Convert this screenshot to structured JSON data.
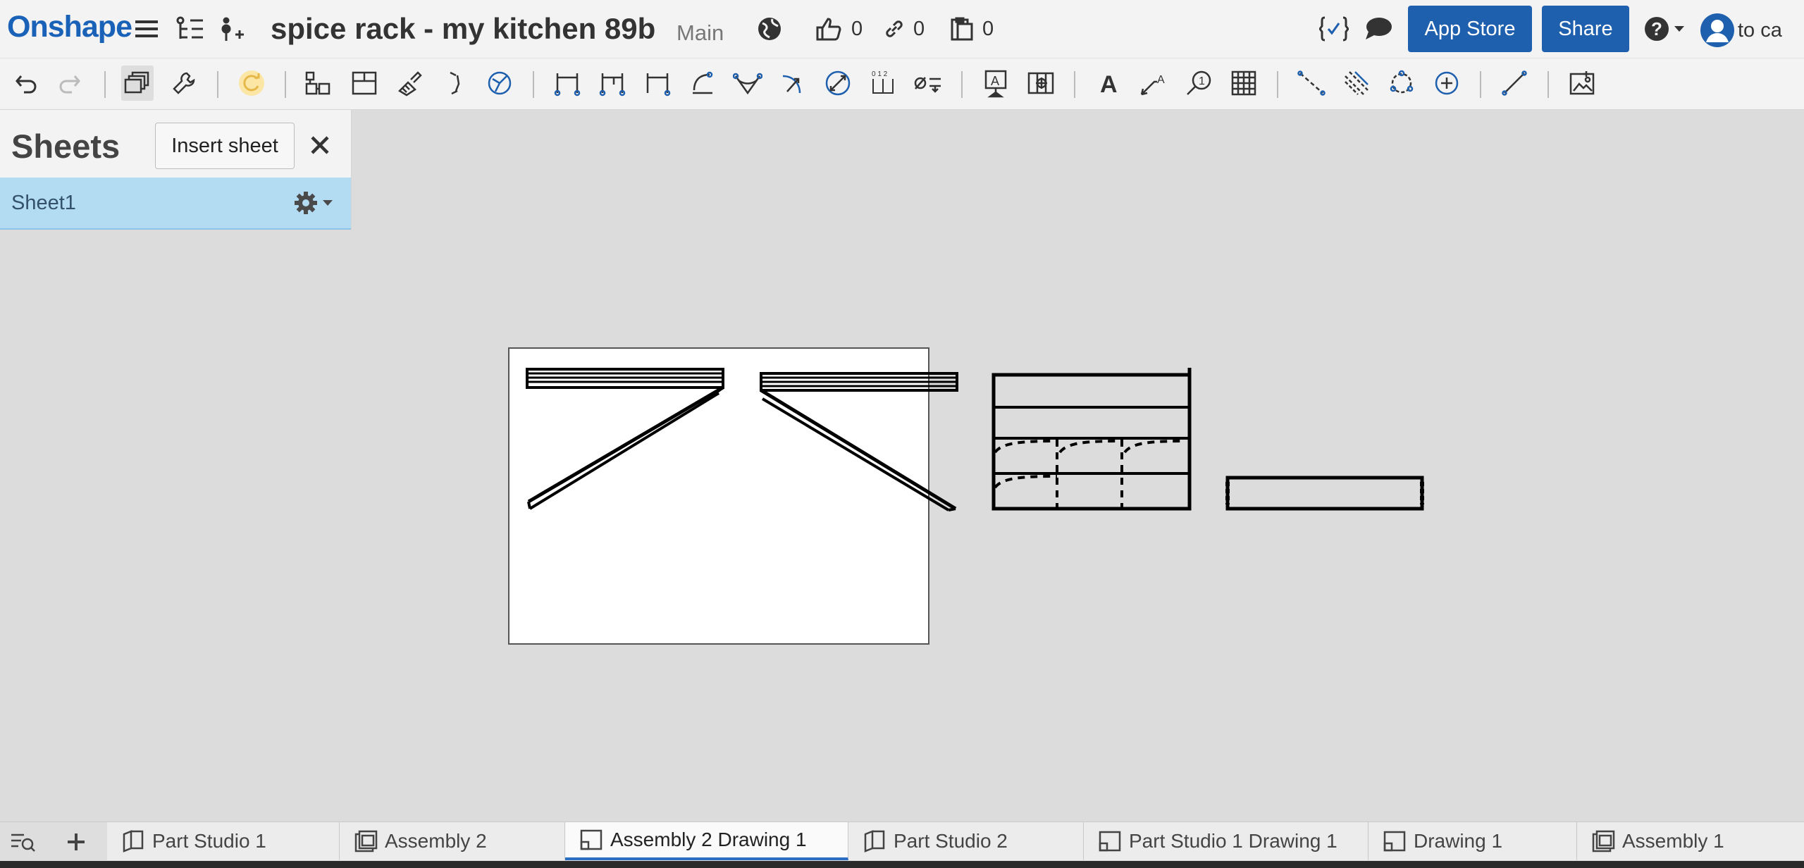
{
  "header": {
    "logo": "Onshape",
    "document_title": "spice rack - my kitchen 89b",
    "branch": "Main",
    "likes_count": "0",
    "links_count": "0",
    "copies_count": "0",
    "app_store_label": "App Store",
    "share_label": "Share",
    "user_label": "to ca"
  },
  "toolbar": {
    "icons": [
      "undo-icon",
      "redo-icon",
      "sheet-view-icon",
      "wrench-icon",
      "regenerate-icon",
      "insert-view-icon",
      "projected-view-icon",
      "section-view-icon",
      "detail-view-icon",
      "auxiliary-view-icon",
      "linear-dimension-icon",
      "baseline-dimension-icon",
      "ordinate-dimension-icon",
      "angular-dimension-icon",
      "arc-length-icon",
      "radial-dimension-icon",
      "diameter-dimension-icon",
      "hole-table-icon",
      "hole-callout-icon",
      "datum-icon",
      "frame-icon",
      "note-icon",
      "leader-icon",
      "callout-icon",
      "table-icon",
      "centerline-icon",
      "hatch-icon",
      "centermark-icon",
      "bolt-circle-icon",
      "line-icon",
      "insert-image-icon"
    ]
  },
  "sheets_panel": {
    "title": "Sheets",
    "insert_label": "Insert sheet",
    "sheets": [
      {
        "name": "Sheet1",
        "selected": true
      }
    ]
  },
  "tabs": [
    {
      "label": "Part Studio 1",
      "icon": "part-studio-icon",
      "active": false
    },
    {
      "label": "Assembly 2",
      "icon": "assembly-icon",
      "active": false
    },
    {
      "label": "Assembly 2 Drawing 1",
      "icon": "drawing-icon",
      "active": true
    },
    {
      "label": "Part Studio 2",
      "icon": "part-studio-icon",
      "active": false
    },
    {
      "label": "Part Studio 1 Drawing 1",
      "icon": "drawing-icon",
      "active": false
    },
    {
      "label": "Drawing 1",
      "icon": "drawing-icon",
      "active": false
    },
    {
      "label": "Assembly 1",
      "icon": "assembly-icon",
      "active": false
    }
  ],
  "colors": {
    "brand": "#1a62b8",
    "button": "#1e5fae",
    "selected_sheet": "#b3dcf3",
    "active_tab_underline": "#2a6ec4"
  }
}
